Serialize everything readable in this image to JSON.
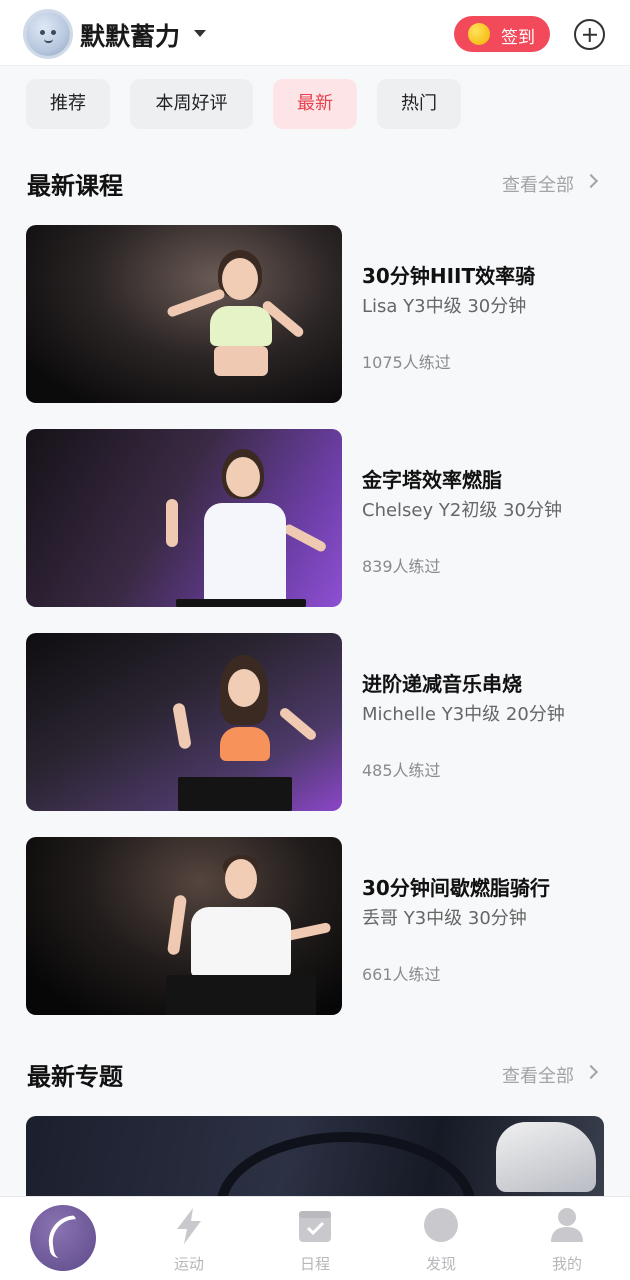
{
  "header": {
    "username": "默默蓄力",
    "signin_label": "签到"
  },
  "tabs": [
    {
      "label": "推荐",
      "active": false
    },
    {
      "label": "本周好评",
      "active": false
    },
    {
      "label": "最新",
      "active": true
    },
    {
      "label": "热门",
      "active": false
    }
  ],
  "latest_courses": {
    "title": "最新课程",
    "see_all": "查看全部",
    "items": [
      {
        "title": "30分钟HIIT效率骑",
        "meta": "Lisa Y3中级 30分钟",
        "count": "1075人练过"
      },
      {
        "title": "金字塔效率燃脂",
        "meta": "Chelsey Y2初级 30分钟",
        "count": "839人练过"
      },
      {
        "title": "进阶递减音乐串烧",
        "meta": "Michelle Y3中级 20分钟",
        "count": "485人练过"
      },
      {
        "title": "30分钟间歇燃脂骑行",
        "meta": "丢哥 Y3中级 30分钟",
        "count": "661人练过"
      }
    ]
  },
  "latest_topics": {
    "title": "最新专题",
    "see_all": "查看全部"
  },
  "bottom_nav": {
    "items": [
      {
        "label": "运动",
        "icon": "lightning-icon"
      },
      {
        "label": "日程",
        "icon": "calendar-check-icon"
      },
      {
        "label": "发现",
        "icon": "compass-icon"
      },
      {
        "label": "我的",
        "icon": "person-icon"
      }
    ]
  },
  "colors": {
    "accent": "#f24a5a",
    "active_tab_bg": "#fde5e7",
    "active_tab_text": "#e8404f",
    "brand_purple": "#6b5599"
  }
}
